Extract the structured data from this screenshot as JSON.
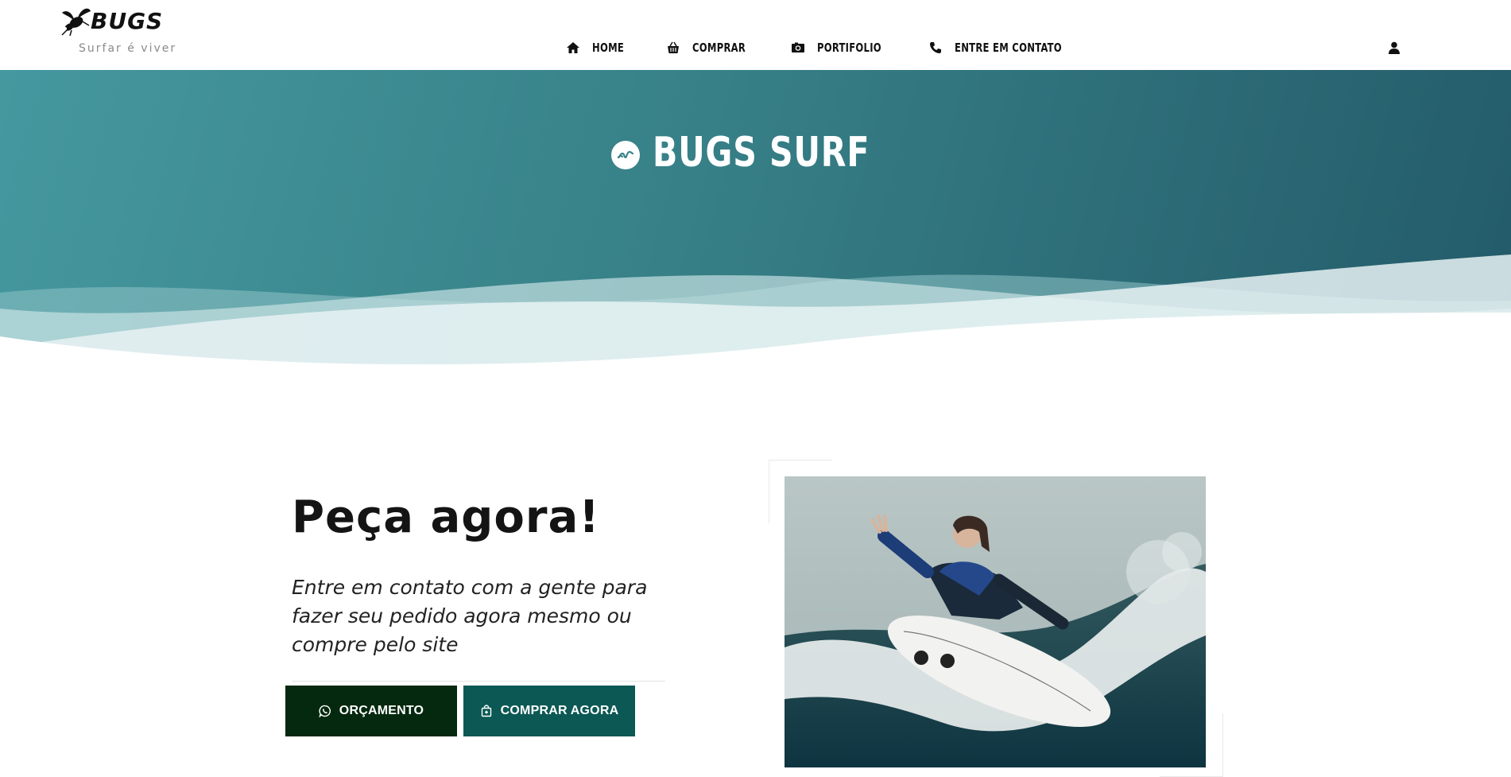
{
  "header": {
    "logo_text": "BUGS",
    "tagline": "Surfar é viver",
    "logo_icon": "bee-icon",
    "nav": [
      {
        "label": "HOME",
        "icon": "home-icon"
      },
      {
        "label": "COMPRAR",
        "icon": "basket-icon"
      },
      {
        "label": "PORTIFOLIO",
        "icon": "camera-icon"
      },
      {
        "label": "ENTRE EM CONTATO",
        "icon": "phone-icon"
      }
    ],
    "user_icon": "user-icon"
  },
  "hero": {
    "title": "BUGS SURF",
    "title_icon": "wave-icon",
    "gradient": [
      "#45989f",
      "#235a69"
    ]
  },
  "cta": {
    "title": "Peça agora!",
    "text": "Entre em contato com a gente para fazer seu pedido agora mesmo ou compre pelo site",
    "buttons": [
      {
        "label": "ORÇAMENTO",
        "icon": "whatsapp-icon",
        "color": "#04290f"
      },
      {
        "label": "COMPRAR AGORA",
        "icon": "shopping-bag-icon",
        "color": "#0b5854"
      }
    ]
  },
  "photo": {
    "subject": "surfer-photo"
  }
}
